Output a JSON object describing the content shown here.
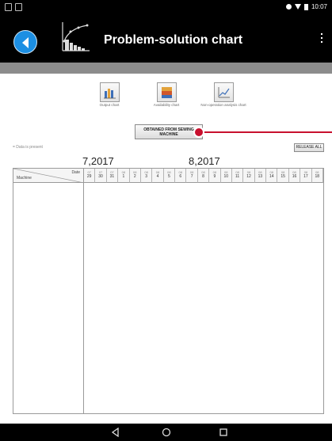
{
  "status_bar": {
    "time": "10:07",
    "icons": [
      "notification-icon",
      "sim-icon",
      "dnd-icon",
      "wifi-icon",
      "battery-icon"
    ]
  },
  "app_bar": {
    "title": "Problem-solution chart",
    "icons": [
      "back-arrow-icon",
      "pareto-chart-icon",
      "overflow-menu-icon"
    ]
  },
  "chart_tiles": [
    {
      "label": "Output chart",
      "icon": "bar-chart-icon"
    },
    {
      "label": "Availability chart",
      "icon": "stacked-chart-icon"
    },
    {
      "label": "Non-operation analysis chart",
      "icon": "line-chart-icon"
    }
  ],
  "actions": {
    "obtain_label": "OBTAINED FROM SEWING MACHINE",
    "release_label": "RELEASE ALL"
  },
  "legend_text": "= Data is present",
  "months": {
    "left": "7,2017",
    "right": "8,2017"
  },
  "grid": {
    "header_date": "Date",
    "header_machine": "Machine",
    "dates": [
      {
        "m": "07",
        "d": "29"
      },
      {
        "m": "07",
        "d": "30"
      },
      {
        "m": "07",
        "d": "31"
      },
      {
        "m": "08",
        "d": "1"
      },
      {
        "m": "08",
        "d": "2"
      },
      {
        "m": "08",
        "d": "3"
      },
      {
        "m": "08",
        "d": "4"
      },
      {
        "m": "08",
        "d": "5"
      },
      {
        "m": "08",
        "d": "6"
      },
      {
        "m": "08",
        "d": "7"
      },
      {
        "m": "08",
        "d": "8"
      },
      {
        "m": "08",
        "d": "9"
      },
      {
        "m": "08",
        "d": "10"
      },
      {
        "m": "08",
        "d": "11"
      },
      {
        "m": "08",
        "d": "12"
      },
      {
        "m": "08",
        "d": "13"
      },
      {
        "m": "08",
        "d": "14"
      },
      {
        "m": "08",
        "d": "15"
      },
      {
        "m": "08",
        "d": "16"
      },
      {
        "m": "08",
        "d": "17"
      },
      {
        "m": "08",
        "d": "18"
      }
    ],
    "rows": []
  },
  "colors": {
    "accent_blue": "#1c8fe3",
    "annotation_red": "#c8102e",
    "bar_black": "#000000",
    "gray_band": "#8c8c8c"
  },
  "nav_bar": {
    "icons": [
      "back-triangle-icon",
      "home-circle-icon",
      "recents-square-icon"
    ]
  }
}
